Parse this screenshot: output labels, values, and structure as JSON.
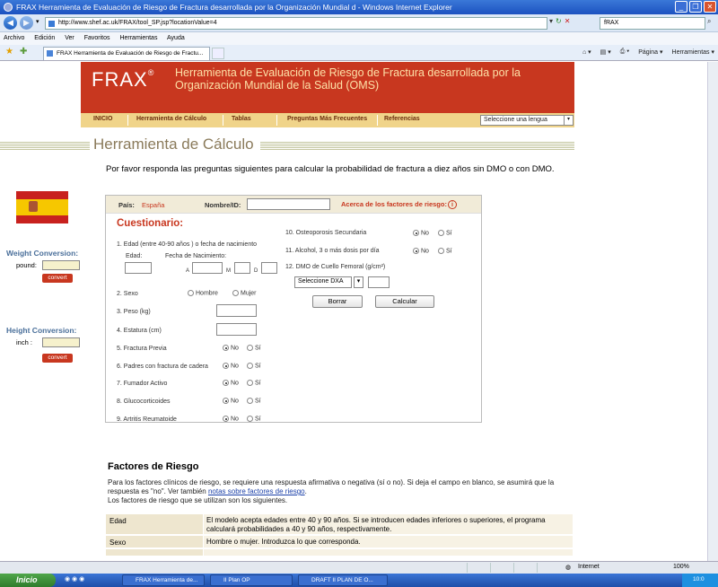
{
  "window": {
    "title": "FRAX Herramienta de Evaluación de Riesgo de Fractura desarrollada por la Organización Mundial d - Windows Internet Explorer"
  },
  "address": {
    "url": "http://www.shef.ac.uk/FRAX/tool_SP.jsp?locationValue=4",
    "search": "fRAX"
  },
  "menubar": [
    "Archivo",
    "Edición",
    "Ver",
    "Favoritos",
    "Herramientas",
    "Ayuda"
  ],
  "tab": {
    "label": "FRAX Herramienta de Evaluación de Riesgo de Fractu..."
  },
  "commandbar": {
    "page": "Página ▾",
    "tools": "Herramientas ▾"
  },
  "site": {
    "logo": "FRAX",
    "logo_mark": "®",
    "title": "Herramienta de Evaluación de Riesgo de Fractura desarrollada por la Organización Mundial de la Salud (OMS)",
    "nav": [
      "INICIO",
      "Herramienta de Cálculo",
      "Tablas",
      "Preguntas Más Frecuentes",
      "Referencias"
    ],
    "language": "Seleccione una lengua",
    "section_title": "Herramienta de Cálculo",
    "intro": "Por favor responda las preguntas siguientes para calcular la probabilidad de fractura a diez años sin DMO o con DMO."
  },
  "sidebar": {
    "weight_title": "Weight Conversion:",
    "weight_unit": "pound:",
    "height_title": "Height Conversion:",
    "height_unit": "inch :",
    "convert": "convert"
  },
  "form": {
    "country_label": "País:",
    "country": "España",
    "name_label": "Nombre/ID:",
    "about_label": "Acerca de los factores de riesgo:",
    "info_glyph": "i",
    "heading": "Cuestionario:",
    "q1": "1. Edad (entre 40-90 años ) o fecha de nacimiento",
    "edad": "Edad:",
    "fecha": "Fecha de Nacimiento:",
    "a": "A",
    "m": "M",
    "d": "D",
    "q2": "2. Sexo",
    "hombre": "Hombre",
    "mujer": "Mujer",
    "q3": "3. Peso (kg)",
    "q4": "4. Estatura (cm)",
    "q5": "5. Fractura Previa",
    "q6": "6. Padres con fractura de cadera",
    "q7": "7. Fumador Activo",
    "q8": "8. Glucocorticoides",
    "q9": "9. Artritis Reumatoide",
    "q10": "10. Osteoporosis Secundaria",
    "q11": "11. Alcohol, 3 o más dosis por día",
    "q12": "12. DMO de Cuello Femoral  (g/cm²)",
    "no": "No",
    "si": "Sí",
    "dxa": "Seleccione DXA",
    "borrar": "Borrar",
    "calcular": "Calcular"
  },
  "factores": {
    "heading": "Factores de Riesgo",
    "text1": "Para los factores clínicos de riesgo, se requiere una respuesta afirmativa o negativa (sí o no). Si deja el campo en blanco, se asumirá que la respuesta es \"no\". Ver también ",
    "link": "notas sobre factores de riesgo",
    "text2": ".",
    "text3": "Los factores de riesgo que se utilizan son los siguientes.",
    "rows": [
      {
        "key": "Edad",
        "val": "El modelo acepta edades entre 40 y 90 años. Si se introducen edades inferiores o superiores, el programa calculará probabilidades a 40 y 90 años, respectivamente."
      },
      {
        "key": "Sexo",
        "val": "Hombre o mujer. Introduzca lo que corresponda."
      }
    ]
  },
  "status": {
    "zone": "Internet",
    "zoom": "100%"
  },
  "taskbar": {
    "start": "Inicio",
    "tasks": [
      "FRAX Herramienta de...",
      "II Plan OP",
      "DRAFT II PLAN DE O..."
    ],
    "clock": "10:0"
  }
}
